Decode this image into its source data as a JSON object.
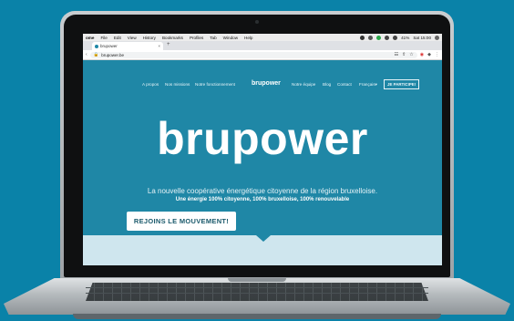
{
  "menubar": {
    "items": [
      "ome",
      "File",
      "Edit",
      "View",
      "History",
      "Bookmarks",
      "Profiles",
      "Tab",
      "Window",
      "Help"
    ],
    "battery": "41%",
    "clock": "Sat 15:00"
  },
  "browser": {
    "tab_title": "brupower",
    "tab_close": "×",
    "new_tab": "+",
    "url": "brupower.be",
    "back": "‹"
  },
  "site": {
    "nav": {
      "about": "A propos",
      "missions": "Nos missions",
      "how": "Notre fonctionnement",
      "logo": "brupower",
      "team": "Notre équipe",
      "blog": "Blog",
      "contact": "Contact",
      "lang": "Français▾",
      "join": "JE PARTICIPE!"
    },
    "hero": {
      "logo": "brupower",
      "tagline": "La nouvelle coopérative énergétique citoyenne de la région bruxelloise.",
      "subtagline": "Une énergie 100% citoyenne, 100% bruxelloise, 100% renouvelable",
      "cta": "REJOINS LE MOUVEMENT!"
    }
  },
  "colors": {
    "background": "#0a82a8",
    "site_teal": "#1f87a6",
    "band": "#cfe6ee",
    "cta_text": "#1b5a6c"
  }
}
